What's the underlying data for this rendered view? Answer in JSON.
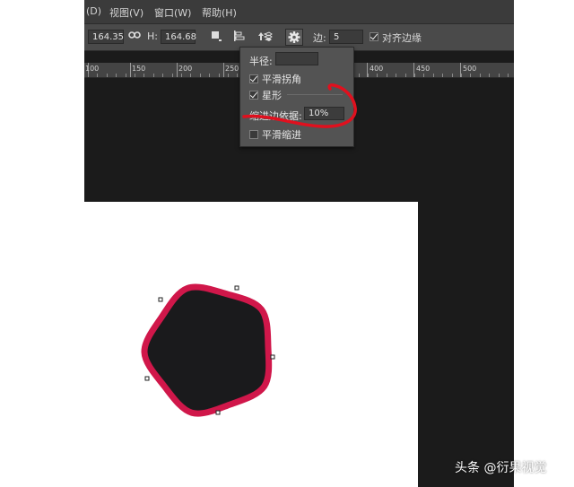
{
  "menu": [
    "(D)",
    "视图(V)",
    "窗口(W)",
    "帮助(H)"
  ],
  "options": {
    "width_value": "164.35",
    "height_label": "H:",
    "height_value": "164.68",
    "sides_label": "边:",
    "sides_value": "5",
    "align_edges_label": "对齐边缘",
    "align_edges_checked": true
  },
  "ruler_labels": [
    "100",
    "150",
    "200",
    "250",
    "400",
    "450",
    "500"
  ],
  "popover": {
    "radius_label": "半径:",
    "radius_value": "",
    "smooth_corners_label": "平滑拐角",
    "smooth_corners_checked": true,
    "star_label": "星形",
    "star_checked": true,
    "indent_label": "缩进边依据:",
    "indent_value": "10%",
    "smooth_indents_label": "平滑缩进",
    "smooth_indents_checked": false
  },
  "colors": {
    "shape_fill": "#1a1a1c",
    "shape_stroke": "#d0174a",
    "annotation": "#e0101e"
  },
  "watermark": "头条 @衍果视觉"
}
